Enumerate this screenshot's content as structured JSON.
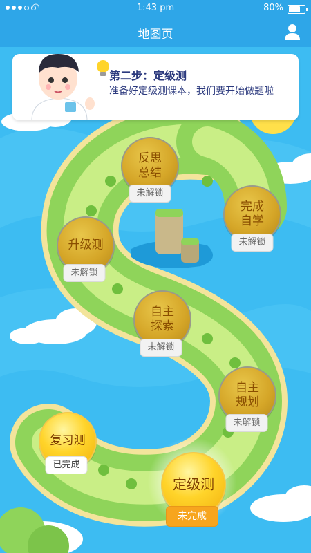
{
  "status_bar": {
    "time": "1:43 pm",
    "battery_percent": "80%",
    "battery_level": 0.8,
    "signal_dots": 5
  },
  "header": {
    "title": "地图页",
    "right_icon": "user-icon"
  },
  "info_card": {
    "avatar": "boy-avatar",
    "icon": "light-bulb-icon",
    "title": "第二步：定级测",
    "description": "准备好定级测课本，我们要开始做题啦"
  },
  "levels": [
    {
      "id": "fansi",
      "label": "反思\n总结",
      "status": "未解锁",
      "state": "locked"
    },
    {
      "id": "wancheng",
      "label": "完成\n自学",
      "status": "未解锁",
      "state": "locked"
    },
    {
      "id": "shengji",
      "label": "升级测",
      "status": "未解锁",
      "state": "locked"
    },
    {
      "id": "zizhu-tansuo",
      "label": "自主\n探索",
      "status": "未解锁",
      "state": "locked"
    },
    {
      "id": "zizhu-guihua",
      "label": "自主\n规划",
      "status": "未解锁",
      "state": "locked"
    },
    {
      "id": "fuxi",
      "label": "复习测",
      "status": "已完成",
      "state": "completed"
    },
    {
      "id": "dingji",
      "label": "定级测",
      "status": "未完成",
      "state": "current"
    }
  ],
  "colors": {
    "sea": "#3dbcf2",
    "header": "#2ea6e8",
    "island": "#8fd45a",
    "path": "#c9ee86",
    "badge_active": "#f7a51e"
  }
}
